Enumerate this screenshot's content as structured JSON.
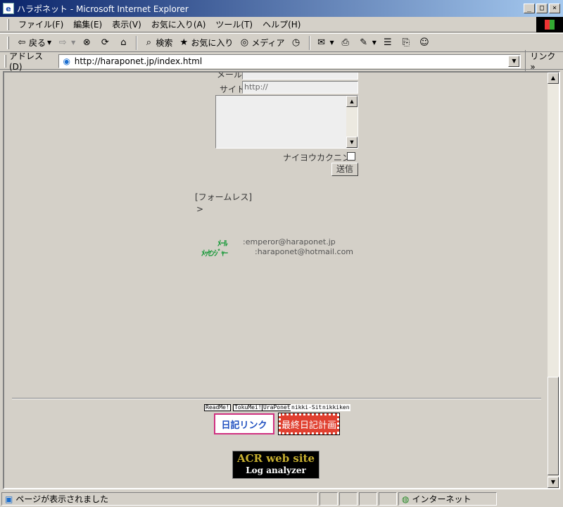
{
  "window": {
    "title": "ハラポネット - Microsoft Internet Explorer",
    "buttons": {
      "minimize": "_",
      "maximize": "□",
      "close": "×"
    }
  },
  "menu": [
    "ファイル(F)",
    "編集(E)",
    "表示(V)",
    "お気に入り(A)",
    "ツール(T)",
    "ヘルプ(H)"
  ],
  "toolbar": {
    "back": "戻る",
    "search": "検索",
    "favorites": "お気に入り",
    "media": "メディア"
  },
  "address": {
    "label": "アドレス(D)",
    "url": "http://haraponet.jp/index.html",
    "links": "リンク"
  },
  "form": {
    "mail_label": "メール",
    "site_label": "サイト",
    "site_value": "http://",
    "confirm_label": "ナイヨウカクニン",
    "submit_label": "送信"
  },
  "content": {
    "formless": "[フォームレス]",
    "prompt": ">",
    "mail_key": "ﾒｰﾙ",
    "mail_value": ":emperor@haraponet.jp",
    "messenger_key": "ﾒｯｾﾝｼﾞｬｰ",
    "messenger_value": ":haraponet@hotmail.com"
  },
  "footer": {
    "badges": [
      "ReadMe!",
      "TokuMei!",
      "UraPonet"
    ],
    "plain_badges": [
      "nikki-Site",
      "nikkiken"
    ],
    "banner_nikki_link": "日記リンク",
    "banner_last_nikki": "最終日記計画",
    "acr_line1": "ACR web site",
    "acr_line2": "Log analyzer"
  },
  "status": {
    "message": "ページが表示されました",
    "zone": "インターネット"
  }
}
